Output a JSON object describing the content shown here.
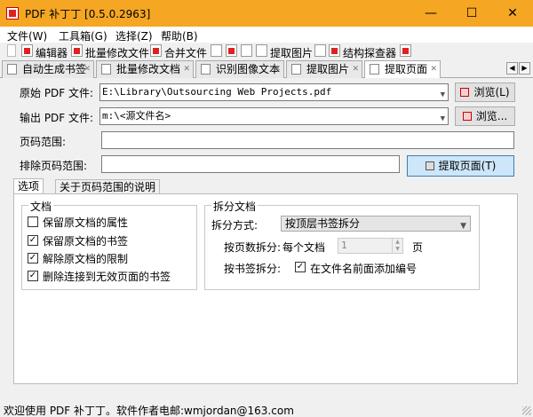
{
  "window": {
    "title": "PDF 补丁丁 [0.5.0.2963]",
    "controls": {
      "minimize": "—",
      "maximize": "☐",
      "close": "✕"
    }
  },
  "menu": [
    "文件(W)",
    "工具箱(G)",
    "选择(Z)",
    "帮助(B)"
  ],
  "toolbar": {
    "editor": "编辑器",
    "batch_modify": "批量修改文件",
    "merge": "合并文件",
    "extract_images": "提取图片",
    "structure_explorer": "结构探查器"
  },
  "tabs": [
    {
      "label": "自动生成书签",
      "active": false
    },
    {
      "label": "批量修改文档",
      "active": false
    },
    {
      "label": "识别图像文本",
      "active": false
    },
    {
      "label": "提取图片",
      "active": false
    },
    {
      "label": "提取页面",
      "active": true
    }
  ],
  "form": {
    "source_label": "原始 PDF 文件:",
    "source_value": "E:\\Library\\Outsourcing Web Projects.pdf",
    "output_label": "输出 PDF 文件:",
    "output_value": "m:\\<源文件名>",
    "browse_1": "浏览(L)",
    "browse_2": "浏览...",
    "page_range_label": "页码范围:",
    "page_range_value": "",
    "exclude_label": "排除页码范围:",
    "exclude_value": "",
    "extract_button": "提取页面(T)"
  },
  "option_tabs": [
    "选项",
    "关于页码范围的说明"
  ],
  "document_group": {
    "title": "文档",
    "items": [
      {
        "label": "保留原文档的属性",
        "checked": false
      },
      {
        "label": "保留原文档的书签",
        "checked": true
      },
      {
        "label": "解除原文档的限制",
        "checked": true
      },
      {
        "label": "删除连接到无效页面的书签",
        "checked": true
      }
    ]
  },
  "split_group": {
    "title": "拆分文档",
    "method_label": "拆分方式:",
    "method_value": "按顶层书签拆分",
    "page_split_label": "按页数拆分:",
    "per_doc_label": "每个文档",
    "pages_value": "1",
    "pages_unit": "页",
    "bookmark_split_label": "按书签拆分:",
    "add_number_label": "在文件名前面添加编号",
    "add_number_checked": true
  },
  "status": "欢迎使用 PDF 补丁丁。软件作者电邮:wmjordan@163.com"
}
